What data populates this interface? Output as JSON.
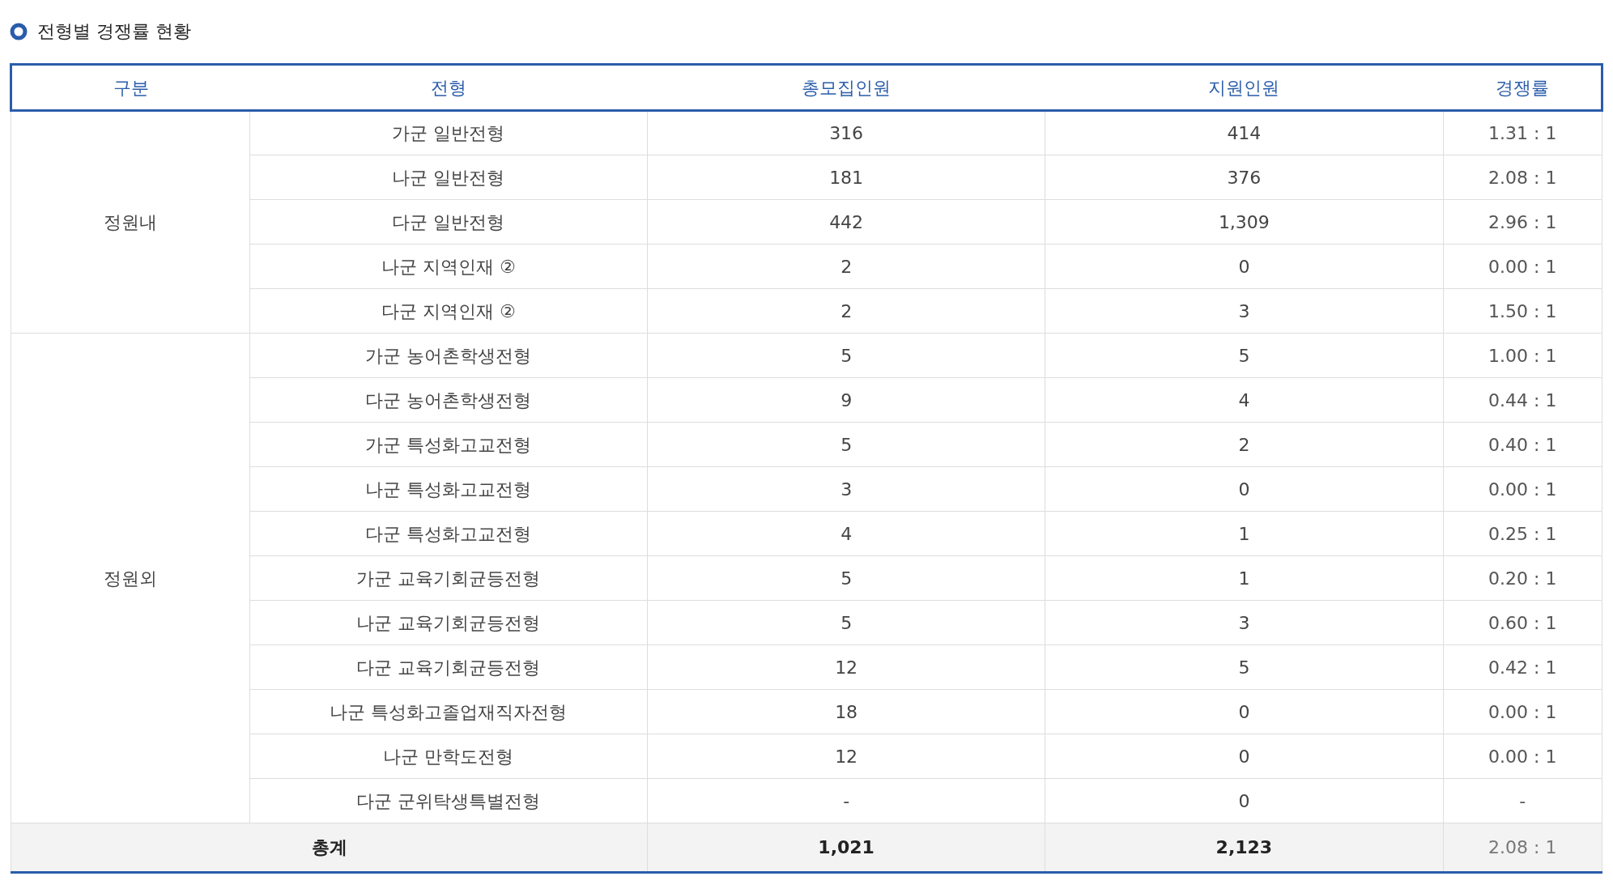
{
  "title": "전형별 경쟁률 현황",
  "table": {
    "columns": [
      "구분",
      "전형",
      "총모집인원",
      "지원인원",
      "경쟁률"
    ],
    "groups": [
      {
        "label": "정원내",
        "rows": [
          [
            "가군 일반전형",
            "316",
            "414",
            "1.31 : 1"
          ],
          [
            "나군 일반전형",
            "181",
            "376",
            "2.08 : 1"
          ],
          [
            "다군 일반전형",
            "442",
            "1,309",
            "2.96 : 1"
          ],
          [
            "나군 지역인재 ②",
            "2",
            "0",
            "0.00 : 1"
          ],
          [
            "다군 지역인재 ②",
            "2",
            "3",
            "1.50 : 1"
          ]
        ]
      },
      {
        "label": "정원외",
        "rows": [
          [
            "가군 농어촌학생전형",
            "5",
            "5",
            "1.00 : 1"
          ],
          [
            "다군 농어촌학생전형",
            "9",
            "4",
            "0.44 : 1"
          ],
          [
            "가군 특성화고교전형",
            "5",
            "2",
            "0.40 : 1"
          ],
          [
            "나군 특성화고교전형",
            "3",
            "0",
            "0.00 : 1"
          ],
          [
            "다군 특성화고교전형",
            "4",
            "1",
            "0.25 : 1"
          ],
          [
            "가군 교육기회균등전형",
            "5",
            "1",
            "0.20 : 1"
          ],
          [
            "나군 교육기회균등전형",
            "5",
            "3",
            "0.60 : 1"
          ],
          [
            "다군 교육기회균등전형",
            "12",
            "5",
            "0.42 : 1"
          ],
          [
            "나군 특성화고졸업재직자전형",
            "18",
            "0",
            "0.00 : 1"
          ],
          [
            "나군 만학도전형",
            "12",
            "0",
            "0.00 : 1"
          ],
          [
            "다군 군위탁생특별전형",
            "-",
            "0",
            "-"
          ]
        ]
      }
    ],
    "total": {
      "label": "총계",
      "cells": [
        "1,021",
        "2,123",
        "2.08 : 1"
      ]
    }
  }
}
